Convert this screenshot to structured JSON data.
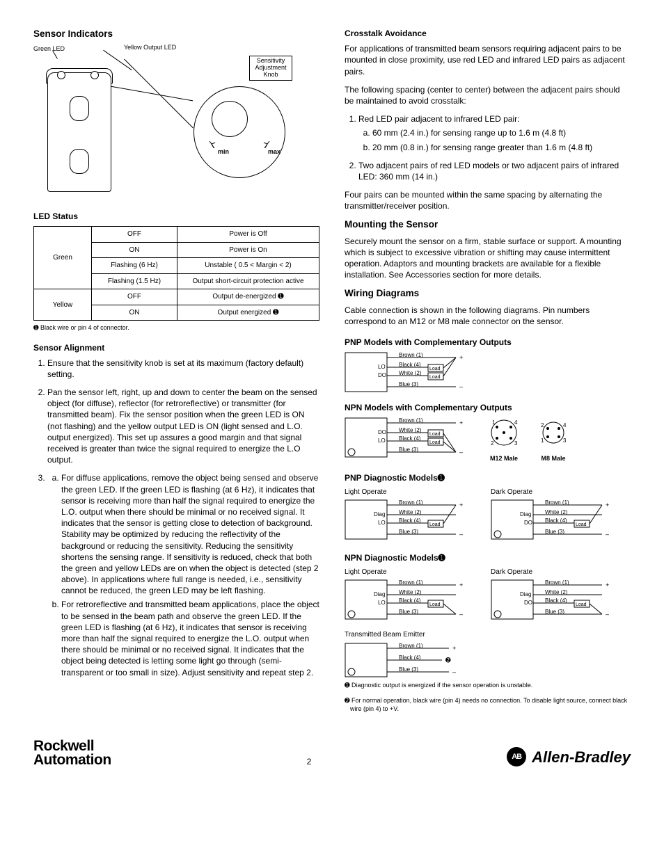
{
  "left": {
    "h_sensor_indicators": "Sensor Indicators",
    "dia": {
      "green_led": "Green LED",
      "yellow_led": "Yellow Output LED",
      "knob": "Sensitivity Adjustment Knob",
      "min": "min",
      "max": "max"
    },
    "h_led_status": "LED Status",
    "led_table": {
      "rows": [
        [
          "Green",
          "OFF",
          "Power is Off"
        ],
        [
          "",
          "ON",
          "Power is On"
        ],
        [
          "",
          "Flashing (6 Hz)",
          "Unstable ( 0.5 < Margin < 2)"
        ],
        [
          "",
          "Flashing (1.5 Hz)",
          "Output short-circuit protection active"
        ],
        [
          "Yellow",
          "OFF",
          "Output de-energized ➊"
        ],
        [
          "",
          "ON",
          "Output energized ➊"
        ]
      ]
    },
    "led_fn": "➊ Black wire or pin 4 of connector.",
    "h_sensor_alignment": "Sensor Alignment",
    "align_1": "Ensure that the sensitivity knob is set at its maximum (factory default) setting.",
    "align_2": "Pan the sensor left, right, up and down to center the beam on the sensed object (for diffuse), reflector (for retroreflective) or transmitter (for transmitted beam). Fix the sensor position when the green LED is ON (not flashing) and the yellow output LED is ON (light sensed and L.O. output energized). This set up assures a good margin and that signal received is greater than twice the signal required to energize the L.O output.",
    "align_3a": "For diffuse applications, remove the object being sensed and observe the green LED. If the green LED is flashing (at 6 Hz), it indicates that sensor is receiving more than half the signal required to energize the L.O. output when there should be minimal or no received signal. It indicates that the sensor is getting close to detection of background. Stability may be optimized by reducing the reflectivity of the background or reducing the sensitivity. Reducing the sensitivity shortens the sensing range. If sensitivity is reduced, check that both the green and yellow LEDs are on when the object is detected (step 2 above). In applications where full range is needed, i.e., sensitivity cannot be reduced, the green LED may be left flashing.",
    "align_3b": "For retroreflective and transmitted beam applications, place the object to be sensed in the beam path and observe the green LED. If the green LED is flashing (at 6 Hz), it indicates that sensor is receiving more than half the signal required to energize the L.O. output when there should be minimal or no received signal. It indicates that the object being detected is letting some light go through (semi-transparent or too small in size). Adjust sensitivity and repeat step 2."
  },
  "right": {
    "h_crosstalk": "Crosstalk Avoidance",
    "ct_p1": "For applications of transmitted beam sensors requiring adjacent pairs to be mounted in close proximity, use red LED and infrared LED pairs as adjacent pairs.",
    "ct_p2": "The following spacing (center to center) between the adjacent pairs should be maintained to avoid crosstalk:",
    "ct_1": "Red LED pair adjacent to infrared LED pair:",
    "ct_1a": "60 mm (2.4 in.) for sensing range up to 1.6 m (4.8 ft)",
    "ct_1b": "20 mm (0.8 in.) for sensing range greater than 1.6 m (4.8 ft)",
    "ct_2": "Two adjacent pairs of red LED models or two adjacent pairs of infrared LED: 360 mm (14 in.)",
    "ct_p3": "Four pairs can be mounted within the same spacing by alternating the transmitter/receiver position.",
    "h_mounting": "Mounting the Sensor",
    "mount_p": "Securely mount the sensor on a firm, stable surface or support. A mounting which is subject to excessive vibration or shifting may cause intermittent operation. Adaptors and mounting brackets are available for a flexible installation. See Accessories section for more details.",
    "h_wiring": "Wiring Diagrams",
    "wiring_p": "Cable connection is shown in the following diagrams. Pin numbers correspond to an M12 or M8 male connector on the sensor.",
    "h_pnp_comp": "PNP Models with Complementary Outputs",
    "h_npn_comp": "NPN Models with Complementary Outputs",
    "h_pnp_diag": "PNP Diagnostic Models➊",
    "h_npn_diag": "NPN Diagnostic Models➊",
    "light_op": "Light Operate",
    "dark_op": "Dark Operate",
    "tx_emitter": "Transmitted Beam Emitter",
    "wires": {
      "brown": "Brown (1)",
      "black": "Black (4)",
      "white": "White (2)",
      "blue": "Blue (3)",
      "diag": "Diag",
      "lo": "LO",
      "do": "DO",
      "load": "Load",
      "plus": "+",
      "minus": "–",
      "note2": "➋"
    },
    "m12": "M12 Male",
    "m8": "M8 Male",
    "pins": {
      "p1": "1",
      "p2": "2",
      "p3": "3",
      "p4": "4"
    },
    "diag_fn1": "➊ Diagnostic output is energized if the sensor operation is unstable.",
    "diag_fn2": "➋ For normal operation, black wire (pin 4) needs no connection. To disable light source, connect black wire (pin 4) to +V."
  },
  "footer": {
    "ra1": "Rockwell",
    "ra2": "Automation",
    "page": "2",
    "ab": "Allen-Bradley",
    "ab_badge": "AB"
  }
}
